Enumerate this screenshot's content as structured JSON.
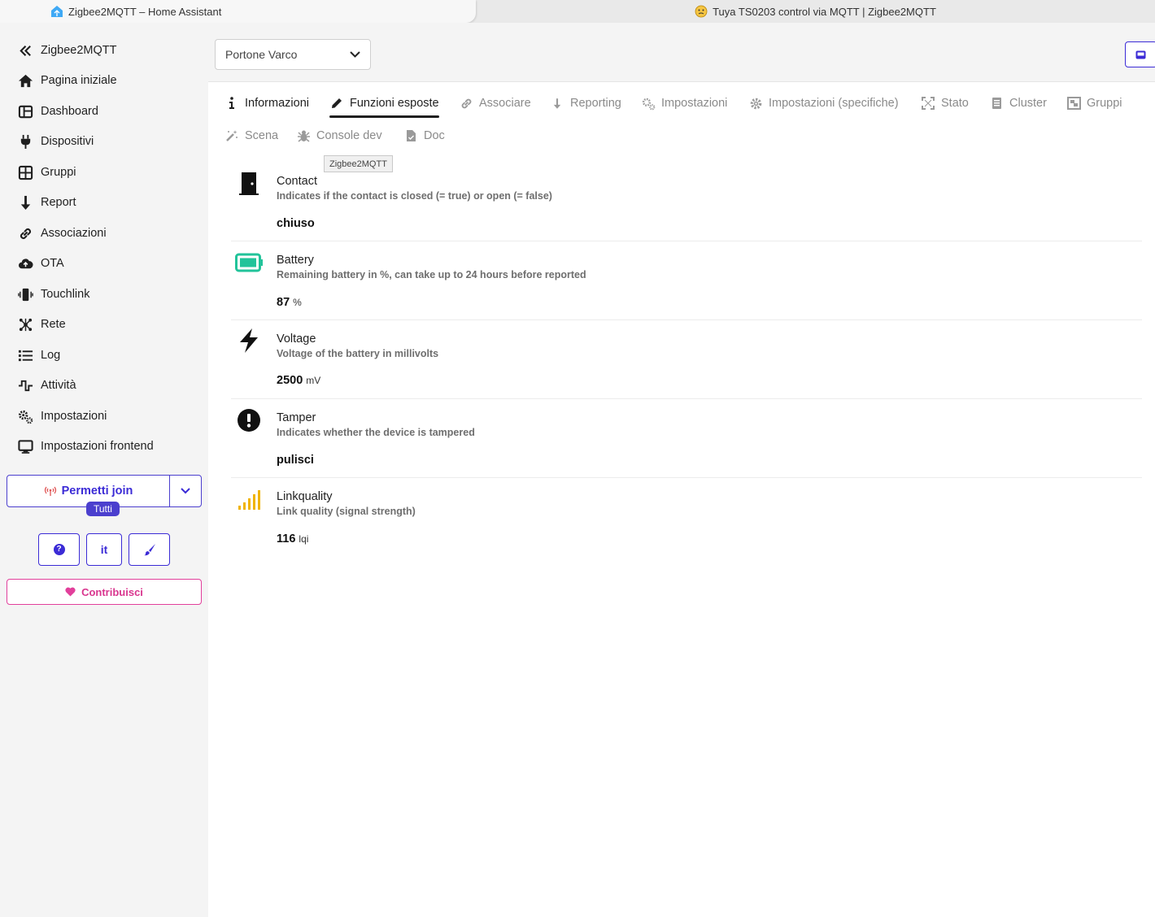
{
  "browser": {
    "tabs": [
      {
        "title": "Zigbee2MQTT – Home Assistant",
        "icon": "home-assistant-icon"
      },
      {
        "title": "Tuya TS0203 control via MQTT | Zigbee2MQTT",
        "icon": "emoji-face-icon"
      }
    ]
  },
  "sidebar": {
    "items": [
      {
        "label": "Zigbee2MQTT",
        "icon": "chevron-double-left-icon"
      },
      {
        "label": "Pagina iniziale",
        "icon": "home-icon"
      },
      {
        "label": "Dashboard",
        "icon": "dashboard-icon"
      },
      {
        "label": "Dispositivi",
        "icon": "plug-icon"
      },
      {
        "label": "Gruppi",
        "icon": "grid-icon"
      },
      {
        "label": "Report",
        "icon": "arrow-down-icon"
      },
      {
        "label": "Associazioni",
        "icon": "link-icon"
      },
      {
        "label": "OTA",
        "icon": "cloud-upload-icon"
      },
      {
        "label": "Touchlink",
        "icon": "phone-vibrate-icon"
      },
      {
        "label": "Rete",
        "icon": "network-icon"
      },
      {
        "label": "Log",
        "icon": "list-icon"
      },
      {
        "label": "Attività",
        "icon": "pulse-icon"
      },
      {
        "label": "Impostazioni",
        "icon": "cogs-icon"
      },
      {
        "label": "Impostazioni frontend",
        "icon": "monitor-icon"
      }
    ],
    "join": {
      "label": "Permetti join",
      "badge": "Tutti"
    },
    "buttons": {
      "help": "?",
      "language": "it"
    },
    "contribute": "Contribuisci"
  },
  "header": {
    "device_select": "Portone Varco"
  },
  "tabs": [
    {
      "label": "Informazioni",
      "icon": "info-icon"
    },
    {
      "label": "Funzioni esposte",
      "icon": "pencil-icon",
      "active": true
    },
    {
      "label": "Associare",
      "icon": "link-icon"
    },
    {
      "label": "Reporting",
      "icon": "arrow-down-icon"
    },
    {
      "label": "Impostazioni",
      "icon": "cogs-icon"
    },
    {
      "label": "Impostazioni (specifiche)",
      "icon": "gear-icon"
    },
    {
      "label": "Stato",
      "icon": "expand-icon"
    },
    {
      "label": "Cluster",
      "icon": "document-icon"
    },
    {
      "label": "Gruppi",
      "icon": "object-group-icon"
    },
    {
      "label": "Scena",
      "icon": "magic-wand-icon"
    },
    {
      "label": "Console dev",
      "icon": "bug-icon"
    },
    {
      "label": "Doc",
      "icon": "file-icon"
    }
  ],
  "tooltip": "Zigbee2MQTT",
  "features": [
    {
      "name": "Contact",
      "description": "Indicates if the contact is closed (= true) or open (= false)",
      "value": "chiuso",
      "unit": "",
      "icon": "door-icon"
    },
    {
      "name": "Battery",
      "description": "Remaining battery in %, can take up to 24 hours before reported",
      "value": "87",
      "unit": "%",
      "icon": "battery-full-icon"
    },
    {
      "name": "Voltage",
      "description": "Voltage of the battery in millivolts",
      "value": "2500",
      "unit": "mV",
      "icon": "bolt-icon"
    },
    {
      "name": "Tamper",
      "description": "Indicates whether the device is tampered",
      "value": "pulisci",
      "unit": "",
      "icon": "exclamation-circle-icon"
    },
    {
      "name": "Linkquality",
      "description": "Link quality (signal strength)",
      "value": "116",
      "unit": "lqi",
      "icon": "signal-bars-icon"
    }
  ],
  "colors": {
    "accent": "#3b2bd6",
    "contribute": "#e23f9b",
    "battery": "#22c39a",
    "signal": "#f0b400"
  }
}
